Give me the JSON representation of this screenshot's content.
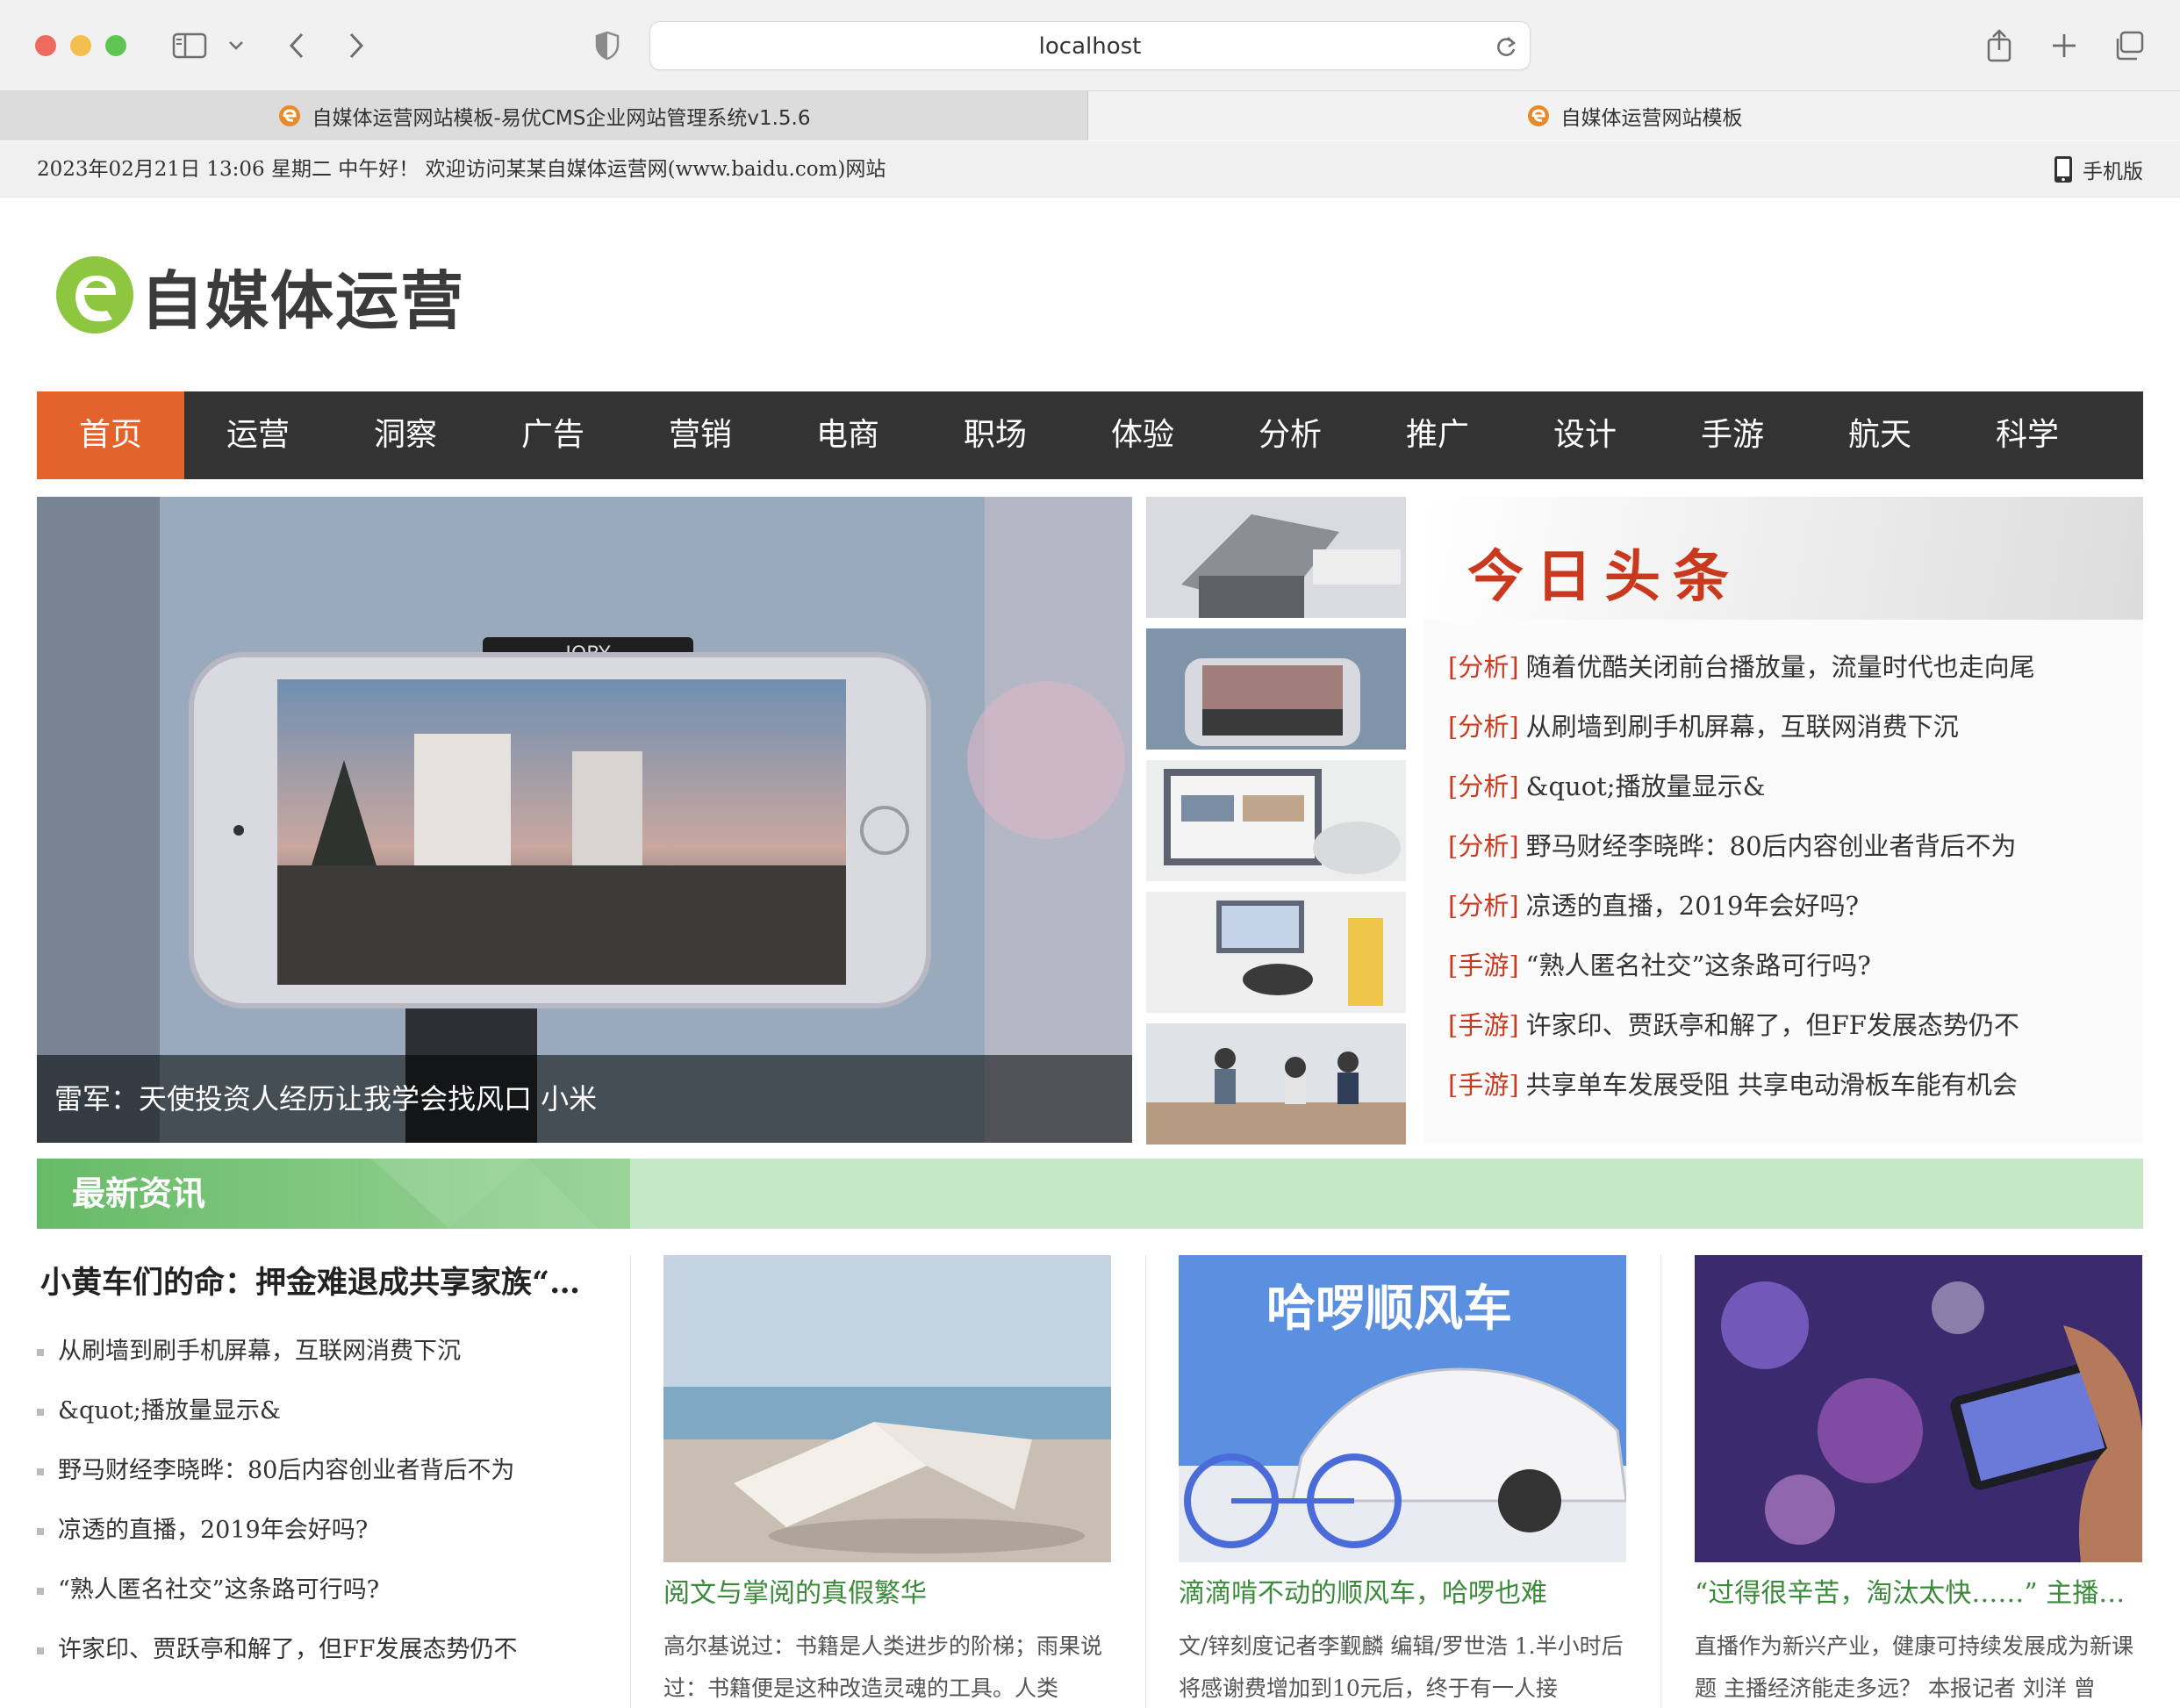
{
  "browser": {
    "url": "localhost",
    "tabs": [
      {
        "label": "自媒体运营网站模板-易优CMS企业网站管理系统v1.5.6"
      },
      {
        "label": "自媒体运营网站模板"
      }
    ]
  },
  "topbar": {
    "greeting": "2023年02月21日 13:06 星期二 中午好！ 欢迎访问某某自媒体运营网(www.baidu.com)网站",
    "mobile_label": "手机版"
  },
  "logo": {
    "text": "自媒体运营"
  },
  "nav": {
    "items": [
      "首页",
      "运营",
      "洞察",
      "广告",
      "营销",
      "电商",
      "职场",
      "体验",
      "分析",
      "推广",
      "设计",
      "手游",
      "航天",
      "科学"
    ]
  },
  "hero": {
    "caption": "雷军：天使投资人经历让我学会找风口 小米",
    "phone_brand": "JOBY"
  },
  "headlines": {
    "title": "今日头条",
    "items": [
      {
        "cat": "[分析]",
        "text": "随着优酷关闭前台播放量，流量时代也走向尾"
      },
      {
        "cat": "[分析]",
        "text": "从刷墙到刷手机屏幕，互联网消费下沉"
      },
      {
        "cat": "[分析]",
        "text": "&quot;播放量显示&"
      },
      {
        "cat": "[分析]",
        "text": "野马财经李晓晔：80后内容创业者背后不为"
      },
      {
        "cat": "[分析]",
        "text": "凉透的直播，2019年会好吗?"
      },
      {
        "cat": "[手游]",
        "text": "“熟人匿名社交”这条路可行吗?"
      },
      {
        "cat": "[手游]",
        "text": "许家印、贾跃亭和解了，但FF发展态势仍不"
      },
      {
        "cat": "[手游]",
        "text": "共享单车发展受阻 共享电动滑板车能有机会"
      }
    ]
  },
  "latest": {
    "section_title": "最新资讯",
    "featured_title": "小黄车们的命：押金难退成共享家族“…",
    "list": [
      "从刷墙到刷手机屏幕，互联网消费下沉",
      "&quot;播放量显示&",
      "野马财经李晓晔：80后内容创业者背后不为",
      "凉透的直播，2019年会好吗?",
      "“熟人匿名社交”这条路可行吗?",
      "许家印、贾跃亭和解了，但FF发展态势仍不"
    ],
    "cards": [
      {
        "title": "阅文与掌阅的真假繁华",
        "desc": "高尔基说过：书籍是人类进步的阶梯；雨果说过：书籍便是这种改造灵魂的工具。人类"
      },
      {
        "title": "滴滴啃不动的顺风车，哈啰也难",
        "desc": "文/锌刻度记者李觐麟 编辑/罗世浩 1.半小时后将感谢费增加到10元后，终于有一人接",
        "image_text": "哈啰顺风车"
      },
      {
        "title": "“过得很辛苦，淘汰太快……” 主播…",
        "desc": "直播作为新兴产业，健康可持续发展成为新课题 主播经济能走多远？ 本报记者 刘洋 曾"
      }
    ]
  },
  "colors": {
    "nav_bg": "#333333",
    "nav_active": "#e4622b",
    "headline_cat": "#c8391d",
    "section_green": "#67bb68",
    "card_title": "#3b8a3b"
  }
}
